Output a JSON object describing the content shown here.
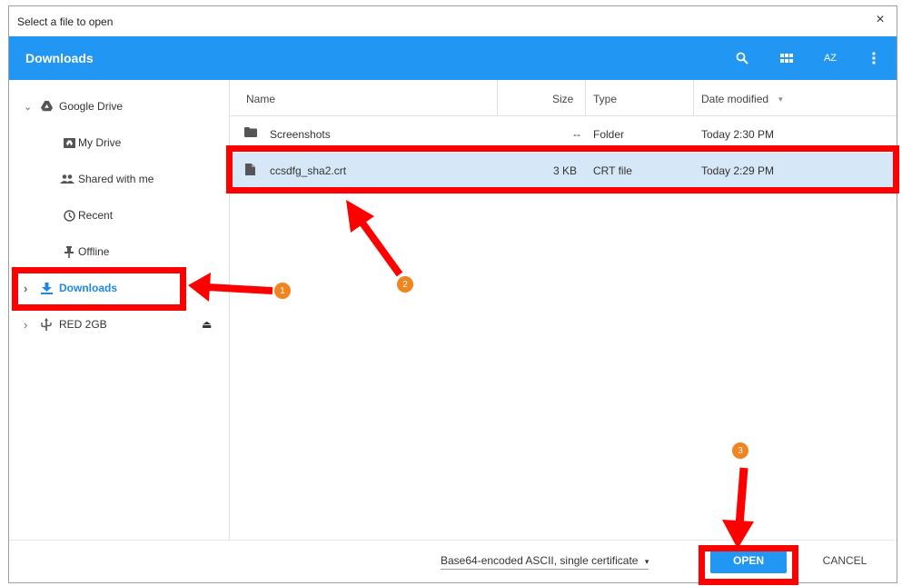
{
  "dialog": {
    "title": "Select a file to open",
    "close_glyph": "×"
  },
  "header": {
    "title": "Downloads",
    "icons": [
      "search-icon",
      "grid-view-icon",
      "sort-az-icon",
      "more-vert-icon"
    ],
    "sort_label": "AZ"
  },
  "sidebar": {
    "items": [
      {
        "label": "Google Drive",
        "icon": "google-drive-icon",
        "chevron": "⌄"
      },
      {
        "label": "My Drive",
        "icon": "my-drive-icon"
      },
      {
        "label": "Shared with me",
        "icon": "shared-icon"
      },
      {
        "label": "Recent",
        "icon": "recent-icon"
      },
      {
        "label": "Offline",
        "icon": "pin-icon"
      },
      {
        "label": "Downloads",
        "icon": "download-icon",
        "chevron": "›",
        "selected": true
      },
      {
        "label": "RED 2GB",
        "icon": "usb-icon",
        "chevron": "›",
        "eject": "⏏"
      }
    ]
  },
  "columns": {
    "name": "Name",
    "size": "Size",
    "type": "Type",
    "date": "Date modified",
    "sort_glyph": "▾"
  },
  "files": [
    {
      "name": "Screenshots",
      "size": "--",
      "type": "Folder",
      "date": "Today 2:30 PM",
      "icon": "folder-icon"
    },
    {
      "name": "ccsdfg_sha2.crt",
      "size": "3 KB",
      "type": "CRT file",
      "date": "Today 2:29 PM",
      "icon": "file-icon",
      "selected": true
    }
  ],
  "footer": {
    "file_type": "Base64-encoded ASCII, single certificate",
    "file_type_caret": "▾",
    "open_label": "OPEN",
    "cancel_label": "CANCEL"
  },
  "annotations": {
    "badges": [
      "1",
      "2",
      "3"
    ],
    "color": "#ff0000",
    "badge_color": "#f0841e"
  }
}
